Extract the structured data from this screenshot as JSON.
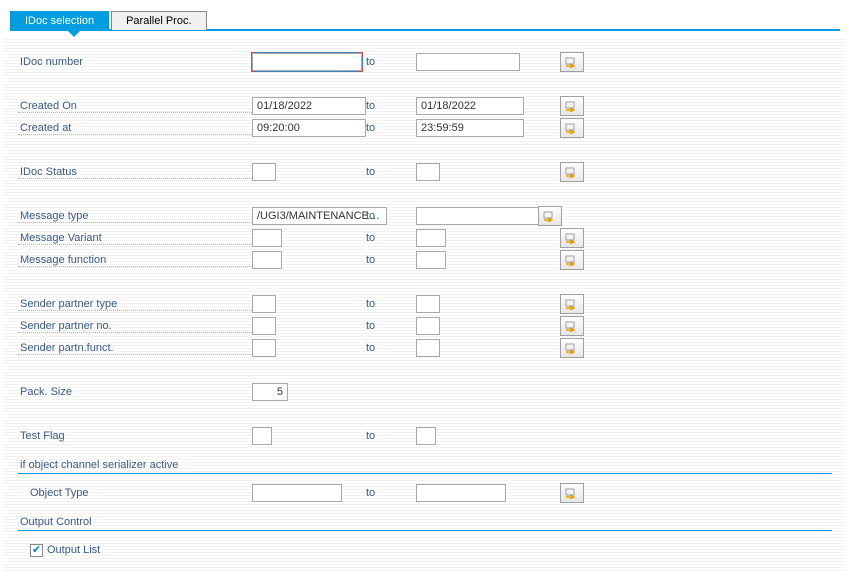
{
  "tabs": [
    "IDoc selection",
    "Parallel Proc."
  ],
  "active_tab": 0,
  "to_label": "to",
  "fields": {
    "idoc_number": {
      "label": "IDoc number",
      "from": "",
      "to": ""
    },
    "created_on": {
      "label": "Created On",
      "from": "01/18/2022",
      "to": "01/18/2022"
    },
    "created_at": {
      "label": "Created at",
      "from": "09:20:00",
      "to": "23:59:59"
    },
    "idoc_status": {
      "label": "IDoc Status",
      "from": "",
      "to": ""
    },
    "message_type": {
      "label": "Message type",
      "from": "/UGI3/MAINTENANCE…",
      "to": ""
    },
    "message_variant": {
      "label": "Message Variant",
      "from": "",
      "to": ""
    },
    "message_function": {
      "label": "Message function",
      "from": "",
      "to": ""
    },
    "sender_ptype": {
      "label": "Sender partner type",
      "from": "",
      "to": ""
    },
    "sender_pno": {
      "label": "Sender partner no.",
      "from": "",
      "to": ""
    },
    "sender_pfunc": {
      "label": "Sender partn.funct.",
      "from": "",
      "to": ""
    },
    "pack_size": {
      "label": "Pack. Size",
      "value": "5"
    },
    "test_flag": {
      "label": "Test Flag",
      "from": "",
      "to": ""
    }
  },
  "group1": {
    "title": "if object channel serializer active",
    "object_type": {
      "label": "Object Type",
      "from": "",
      "to": ""
    }
  },
  "group2": {
    "title": "Output Control",
    "output_list": {
      "label": "Output List",
      "checked": true
    }
  }
}
